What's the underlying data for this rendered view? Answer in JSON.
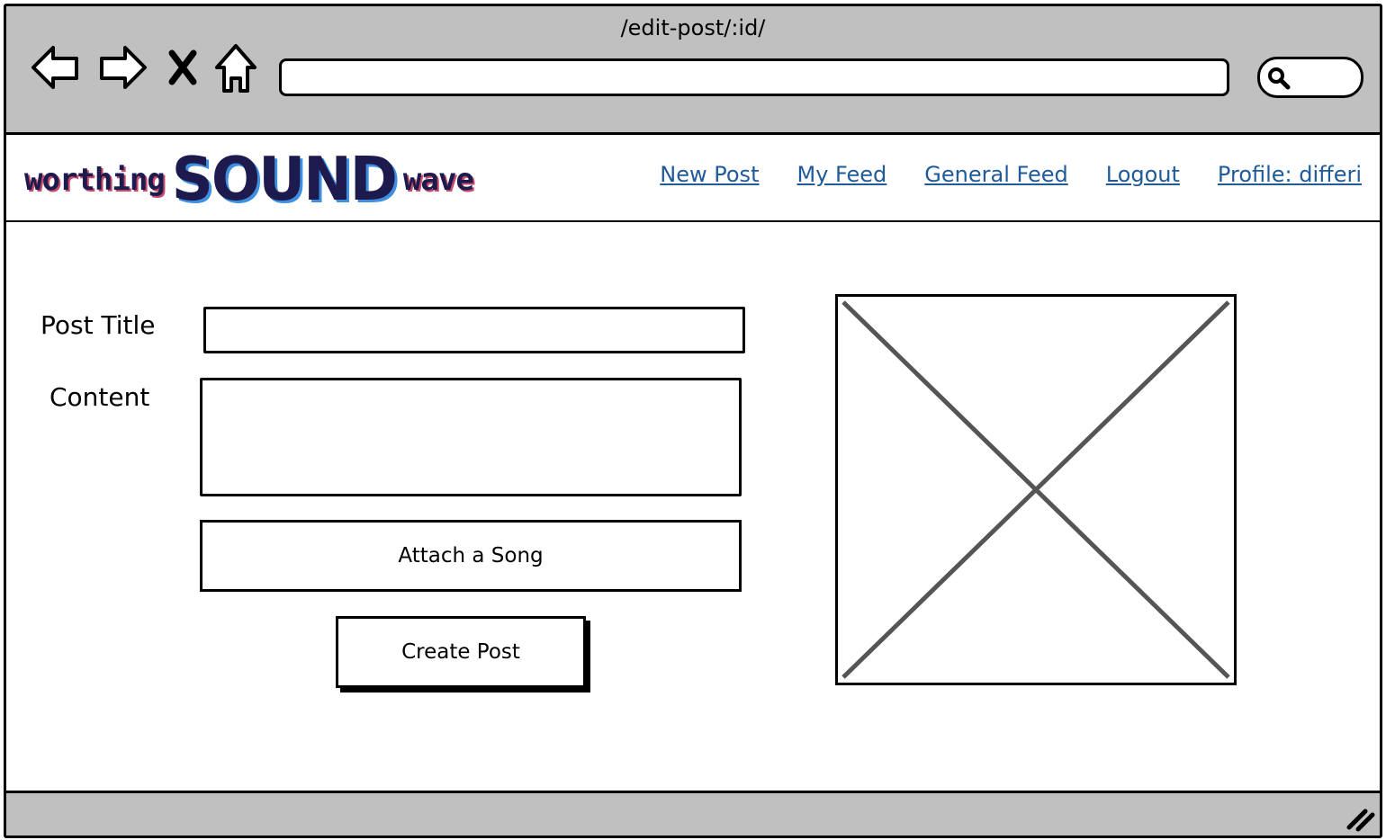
{
  "browser": {
    "url_title": "/edit-post/:id/",
    "icons": [
      "back-arrow-icon",
      "forward-arrow-icon",
      "close-x-icon",
      "home-icon",
      "search-icon",
      "resize-grip-icon"
    ]
  },
  "logo": {
    "part1": "worthing",
    "part2": "SOUND",
    "part3": "wave"
  },
  "nav": {
    "new_post": "New Post",
    "my_feed": "My Feed",
    "general_feed": "General Feed",
    "logout": "Logout",
    "profile": "Profile: differi"
  },
  "form": {
    "title_label": "Post Title",
    "content_label": "Content",
    "attach_button": "Attach a Song",
    "submit_button": "Create Post"
  },
  "colors": {
    "chrome": "#c0c0c0",
    "link": "#1f5a99",
    "logo_primary": "#1d1a4d",
    "logo_accent_blue": "#3f8fe0",
    "logo_accent_red": "#c94a6a"
  }
}
